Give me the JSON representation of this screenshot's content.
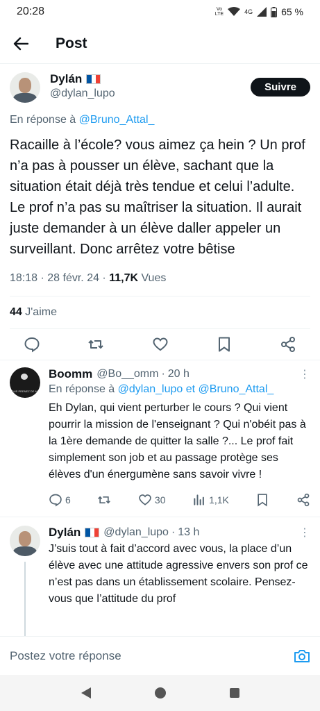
{
  "status": {
    "time": "20:28",
    "volte_top": "Vo",
    "volte_bottom": "LTE",
    "network": "4G",
    "battery": "65 %"
  },
  "header": {
    "title": "Post"
  },
  "post": {
    "author_name": "Dylán",
    "author_handle": "@dylan_lupo",
    "follow_label": "Suivre",
    "reply_prefix": "En réponse à",
    "reply_target": "@Bruno_Attal_",
    "text": "Racaille à l’école? vous aimez ça hein ? Un prof n’a pas à pousser un élève, sachant que la situation était déjà très tendue et celui l’adulte. Le prof n’a pas su maîtriser la situation. Il aurait juste demander à un élève daller appeler un surveillant. Donc arrêtez votre bêtise",
    "time": "18:18",
    "date": "28 févr. 24",
    "views_count": "11,7K",
    "views_label": "Vues",
    "likes_count": "44",
    "likes_label": "J'aime",
    "icons": [
      "reply-icon",
      "retweet-icon",
      "like-icon",
      "bookmark-icon",
      "share-icon"
    ]
  },
  "replies": [
    {
      "name": "Boomm",
      "handle": "@Bo__omm",
      "time": "20 h",
      "reply_prefix": "En réponse à",
      "reply_target1": "@dylan_lupo",
      "reply_and": "et",
      "reply_target2": "@Bruno_Attal_",
      "text": "Eh Dylan, qui vient perturber le cours ? Qui vient pourrir la mission de l'enseignant ? Qui n'obéit pas à la 1ère demande de quitter la salle ?...  Le prof fait simplement son job et au passage protège ses élèves d'un énergumène sans savoir vivre !",
      "replies_count": "6",
      "retweets_count": "",
      "likes_count": "30",
      "views_count": "1,1K",
      "avatar_text": "VOUS PRENEZ DE MOI"
    },
    {
      "name": "Dylán",
      "handle": "@dylan_lupo",
      "time": "13 h",
      "text": "J’suis tout à fait d’accord avec vous, la place d’un élève avec une attitude agressive envers son prof ce n’est pas dans un établissement scolaire. Pensez-vous que l’attitude du prof"
    }
  ],
  "composer": {
    "placeholder": "Postez votre réponse"
  },
  "colors": {
    "accent": "#1d9bf0",
    "text": "#0f1419",
    "secondary": "#536471"
  }
}
